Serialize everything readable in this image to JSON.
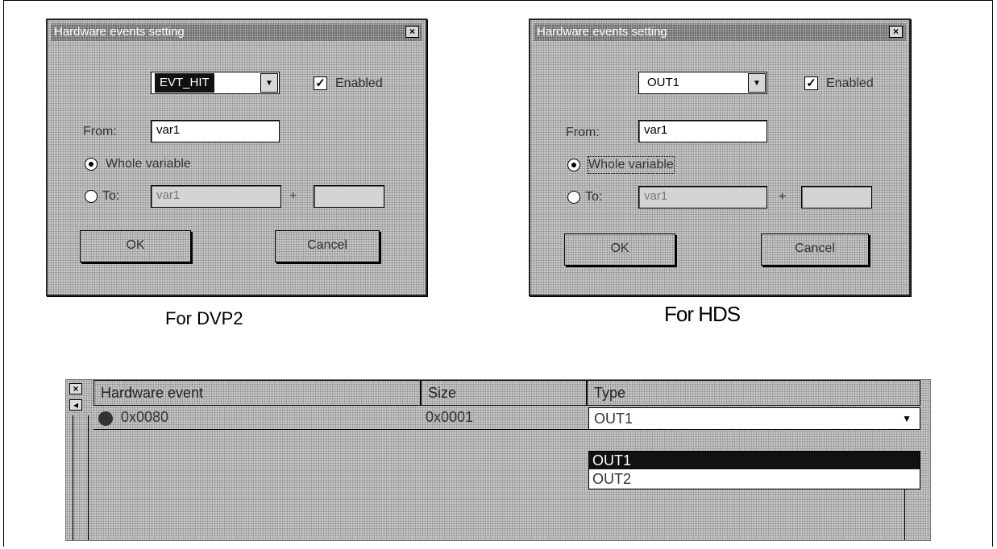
{
  "dialog_dvp2": {
    "title": "Hardware events setting",
    "close": "×",
    "event_select": "EVT_HIT",
    "enabled_label": "Enabled",
    "enabled_check": "✓",
    "from_label": "From:",
    "from_value": "var1",
    "whole_variable_label": "Whole variable",
    "to_label": "To:",
    "to_value": "var1",
    "plus_label": "+",
    "offset_value": "",
    "ok_label": "OK",
    "cancel_label": "Cancel",
    "caption": "For DVP2"
  },
  "dialog_hds": {
    "title": "Hardware events setting",
    "close": "×",
    "event_select": "OUT1",
    "enabled_label": "Enabled",
    "enabled_check": "✓",
    "from_label": "From:",
    "from_value": "var1",
    "whole_variable_label": "Whole variable",
    "to_label": "To:",
    "to_value": "var1",
    "plus_label": "+",
    "offset_value": "",
    "ok_label": "OK",
    "cancel_label": "Cancel",
    "caption": "For HDS"
  },
  "events_table": {
    "close_icon": "×",
    "scroll_left_icon": "◂",
    "columns": [
      "Hardware event",
      "Size",
      "Type"
    ],
    "rows": [
      {
        "event": "0x0080",
        "size": "0x0001",
        "type": "OUT1"
      }
    ],
    "type_options": [
      "OUT1",
      "OUT2"
    ],
    "selected_option": "OUT1"
  },
  "icons": {
    "dropdown": "▼",
    "breakpoint_dot": "dark-circle-icon"
  }
}
